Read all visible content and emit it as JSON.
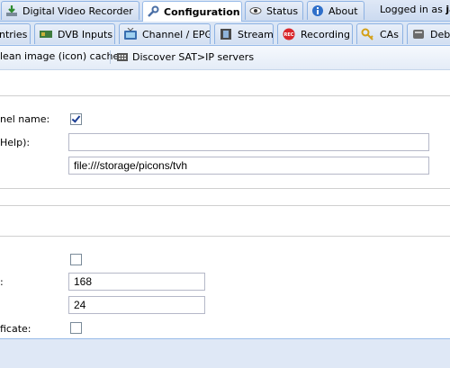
{
  "top_tabs": [
    {
      "label": "Digital Video Recorder",
      "icon": "download-icon"
    },
    {
      "label": "Configuration",
      "icon": "wrench-icon",
      "active": true
    },
    {
      "label": "Status",
      "icon": "eye-icon"
    },
    {
      "label": "About",
      "icon": "info-icon"
    }
  ],
  "logged_in": {
    "prefix": "Logged in as",
    "user": "jar"
  },
  "sub_tabs": [
    {
      "label": "ntries",
      "icon": "none"
    },
    {
      "label": "DVB Inputs",
      "icon": "card-icon"
    },
    {
      "label": "Channel / EPG",
      "icon": "tv-icon"
    },
    {
      "label": "Stream",
      "icon": "film-icon"
    },
    {
      "label": "Recording",
      "icon": "rec-icon"
    },
    {
      "label": "CAs",
      "icon": "key-icon"
    },
    {
      "label": "Deb",
      "icon": "debug-icon"
    }
  ],
  "toolbar": {
    "clean_cache": "lean image (icon) cache",
    "discover_satip": "Discover SAT>IP servers"
  },
  "form": {
    "channel_name_label": "nel name:",
    "channel_name_checked": true,
    "help_label": "Help):",
    "field1_value": "",
    "picon_path": "file:///storage/picons/tvh",
    "number_label": ":",
    "number1": "168",
    "number2": "24",
    "certificate_label": "ficate:"
  },
  "colors": {
    "tab_border": "#8db2e3",
    "bar_bg": "#dbe6f5",
    "rec_red": "#d9262b"
  }
}
